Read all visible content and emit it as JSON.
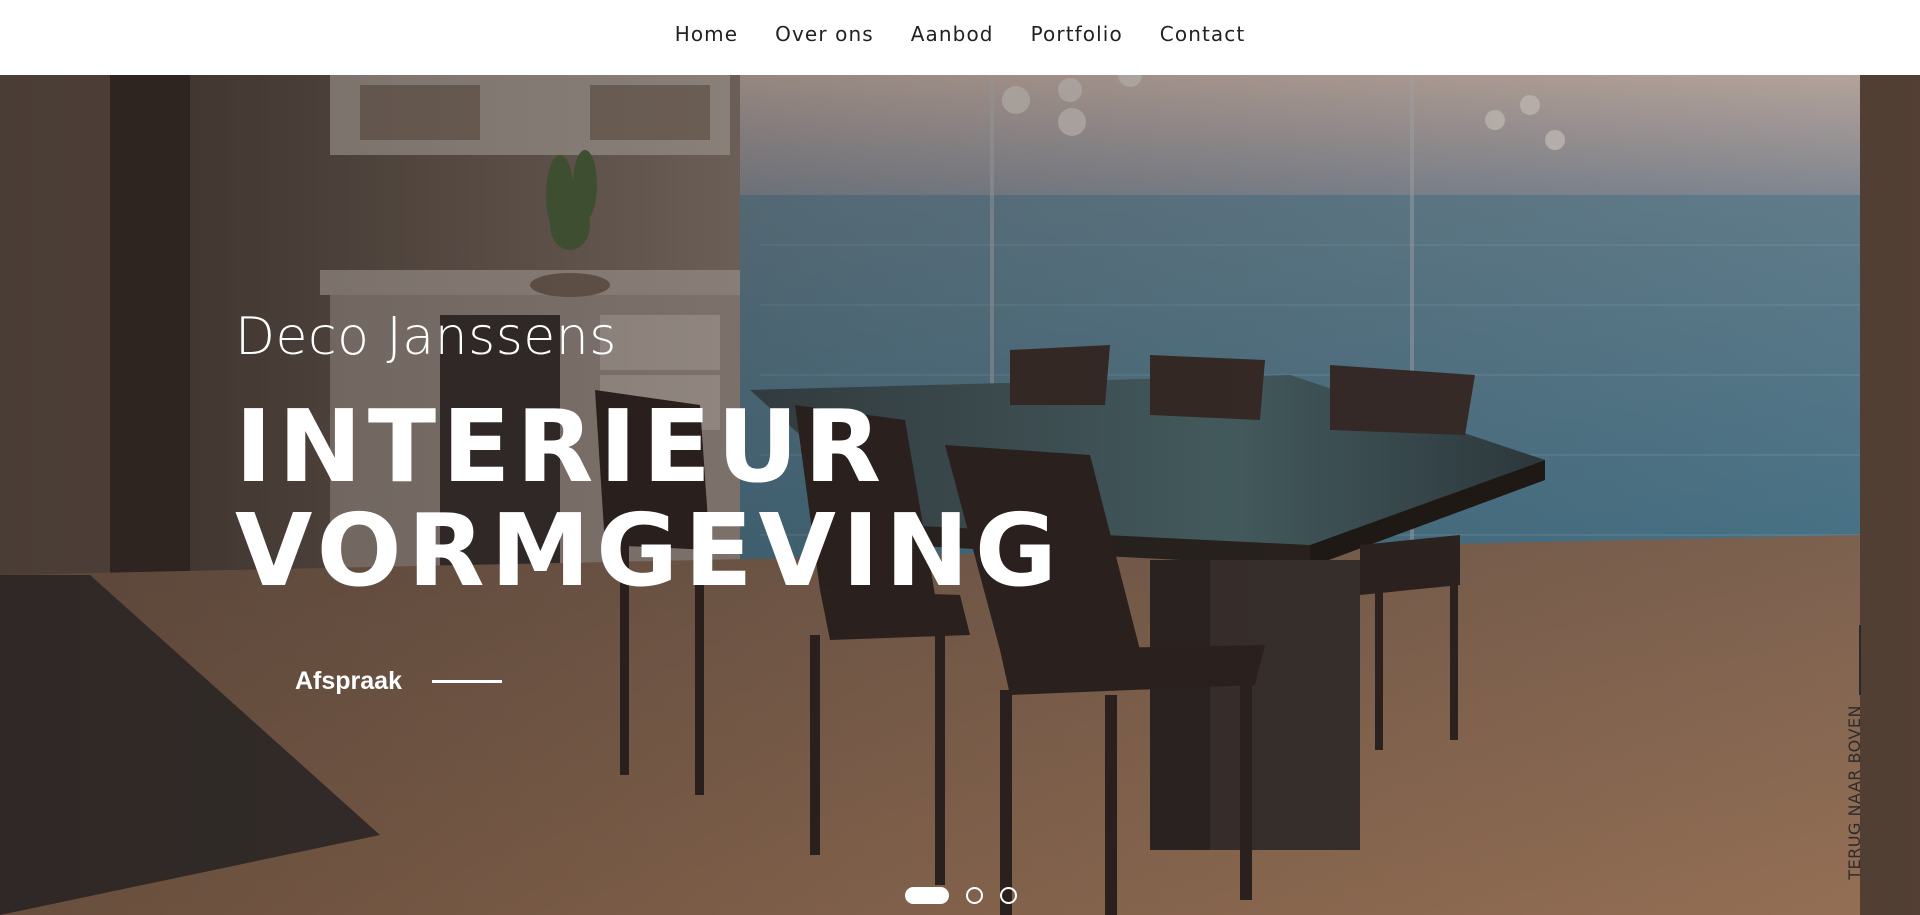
{
  "nav": {
    "items": [
      {
        "label": "Home"
      },
      {
        "label": "Over ons"
      },
      {
        "label": "Aanbod"
      },
      {
        "label": "Portfolio"
      },
      {
        "label": "Contact"
      }
    ]
  },
  "hero": {
    "brand": "Deco Janssens",
    "headline_line1": "INTERIEUR",
    "headline_line2": "VORMGEVING",
    "cta_label": "Afspraak"
  },
  "back_to_top": {
    "label": "TERUG NAAR BOVEN"
  },
  "slider": {
    "count": 3,
    "active_index": 0
  },
  "colors": {
    "accent": "#ffffff",
    "nav_text": "#222222",
    "header_bg": "#ffffff"
  }
}
